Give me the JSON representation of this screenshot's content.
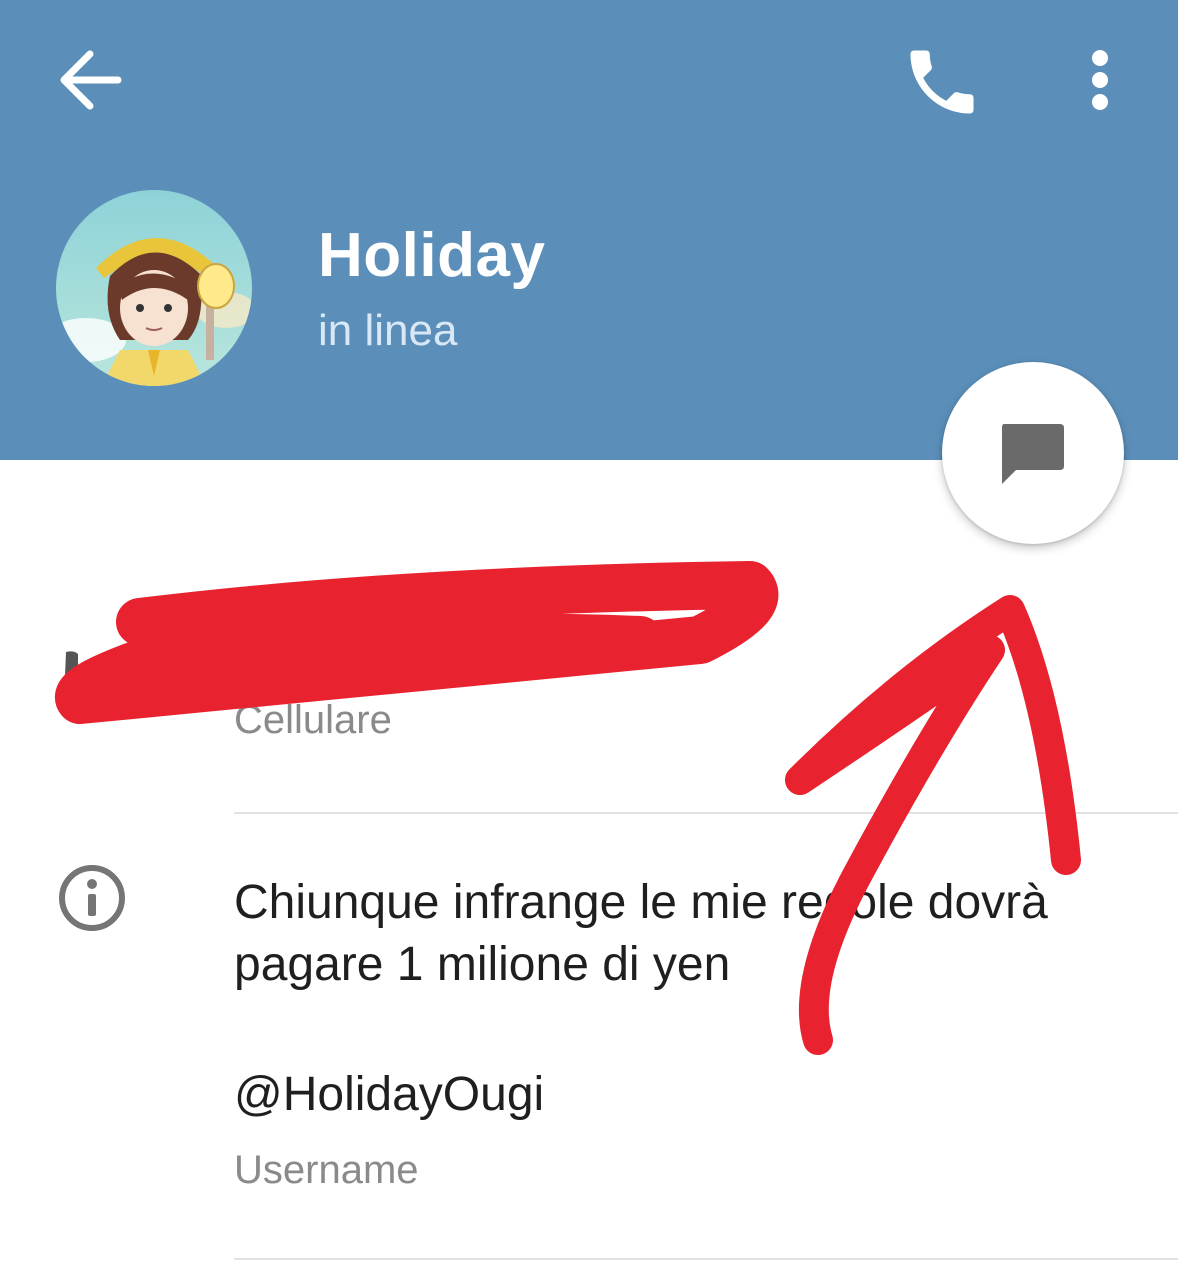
{
  "header": {
    "name": "Holiday",
    "status": "in linea",
    "background_color": "#5b8fba",
    "icons": {
      "back": "arrow-left-icon",
      "call": "phone-icon",
      "more": "more-vertical-icon"
    }
  },
  "fab": {
    "icon": "chat-bubble-icon"
  },
  "contact": {
    "phone_label": "Cellulare",
    "phone_value_redacted": true,
    "bio": "Chiunque infrange le mie regole dovrà pagare 1 milione di yen",
    "username": "@HolidayOugi",
    "username_label": "Username"
  },
  "annotation": {
    "color": "#e8232f",
    "shapes": [
      "scribble-over-phone-number",
      "arrow-to-chat-button"
    ]
  }
}
